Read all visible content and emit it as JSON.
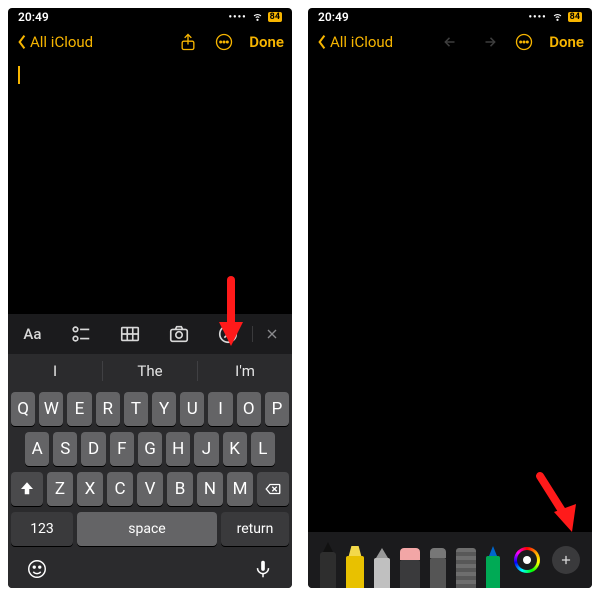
{
  "status": {
    "time": "20:49",
    "battery": "84"
  },
  "nav": {
    "back_label": "All iCloud",
    "done_label": "Done"
  },
  "toolbar": {
    "aa": "Aa"
  },
  "predictions": [
    "I",
    "The",
    "I'm"
  ],
  "keyboard": {
    "row1": [
      "Q",
      "W",
      "E",
      "R",
      "T",
      "Y",
      "U",
      "I",
      "O",
      "P"
    ],
    "row2": [
      "A",
      "S",
      "D",
      "F",
      "G",
      "H",
      "J",
      "K",
      "L"
    ],
    "row3": [
      "Z",
      "X",
      "C",
      "V",
      "B",
      "N",
      "M"
    ],
    "k123": "123",
    "space": "space",
    "return": "return"
  },
  "palette": {
    "tools": [
      "pen",
      "marker",
      "pencil",
      "eraser",
      "lasso",
      "ruler",
      "pen-alt"
    ]
  }
}
